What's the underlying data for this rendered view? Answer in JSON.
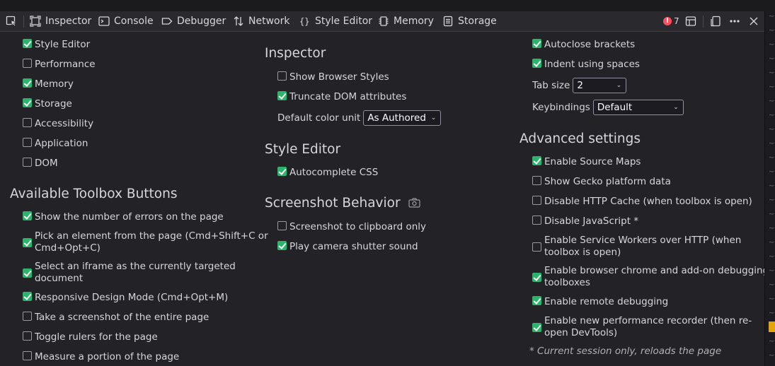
{
  "toolbar": {
    "tabs": [
      {
        "label": "Inspector",
        "icon": "inspector-icon"
      },
      {
        "label": "Console",
        "icon": "console-icon"
      },
      {
        "label": "Debugger",
        "icon": "debugger-icon"
      },
      {
        "label": "Network",
        "icon": "network-icon"
      },
      {
        "label": "Style Editor",
        "icon": "style-editor-icon"
      },
      {
        "label": "Memory",
        "icon": "memory-icon"
      },
      {
        "label": "Storage",
        "icon": "storage-icon"
      }
    ],
    "error_count": "7"
  },
  "col1": {
    "tools": [
      {
        "label": "Style Editor",
        "checked": true
      },
      {
        "label": "Performance",
        "checked": false
      },
      {
        "label": "Memory",
        "checked": true
      },
      {
        "label": "Storage",
        "checked": true
      },
      {
        "label": "Accessibility",
        "checked": false
      },
      {
        "label": "Application",
        "checked": false
      },
      {
        "label": "DOM",
        "checked": false
      }
    ],
    "buttons_title": "Available Toolbox Buttons",
    "buttons": [
      {
        "label": "Show the number of errors on the page",
        "checked": true
      },
      {
        "label": "Pick an element from the page (Cmd+Shift+C or",
        "label2": "Cmd+Opt+C)",
        "checked": true
      },
      {
        "label": "Select an iframe as the currently targeted",
        "label2": "document",
        "checked": true
      },
      {
        "label": "Responsive Design Mode (Cmd+Opt+M)",
        "checked": true
      },
      {
        "label": "Take a screenshot of the entire page",
        "checked": false
      },
      {
        "label": "Toggle rulers for the page",
        "checked": false
      },
      {
        "label": "Measure a portion of the page",
        "checked": false
      }
    ]
  },
  "col2": {
    "inspector_title": "Inspector",
    "inspector": [
      {
        "label": "Show Browser Styles",
        "checked": false
      },
      {
        "label": "Truncate DOM attributes",
        "checked": true
      }
    ],
    "color_unit_label": "Default color unit",
    "color_unit_value": "As Authored",
    "style_editor_title": "Style Editor",
    "style_editor": [
      {
        "label": "Autocomplete CSS",
        "checked": true
      }
    ],
    "screenshot_title": "Screenshot Behavior",
    "screenshot": [
      {
        "label": "Screenshot to clipboard only",
        "checked": false
      },
      {
        "label": "Play camera shutter sound",
        "checked": true
      }
    ]
  },
  "col3": {
    "editor": [
      {
        "label": "Autoclose brackets",
        "checked": true
      },
      {
        "label": "Indent using spaces",
        "checked": true
      }
    ],
    "tab_size_label": "Tab size",
    "tab_size_value": "2",
    "keybindings_label": "Keybindings",
    "keybindings_value": "Default",
    "advanced_title": "Advanced settings",
    "advanced": [
      {
        "label": "Enable Source Maps",
        "checked": true
      },
      {
        "label": "Show Gecko platform data",
        "checked": false
      },
      {
        "label": "Disable HTTP Cache (when toolbox is open)",
        "checked": false
      },
      {
        "label": "Disable JavaScript *",
        "checked": false
      },
      {
        "label": "Enable Service Workers over HTTP (when",
        "label2": "toolbox is open)",
        "checked": false
      },
      {
        "label": "Enable browser chrome and add-on debugging",
        "label2": "toolboxes",
        "checked": true
      },
      {
        "label": "Enable remote debugging",
        "checked": true
      },
      {
        "label": "Enable new performance recorder (then re-",
        "label2": "open DevTools)",
        "checked": true
      }
    ],
    "note": "* Current session only, reloads the page"
  }
}
